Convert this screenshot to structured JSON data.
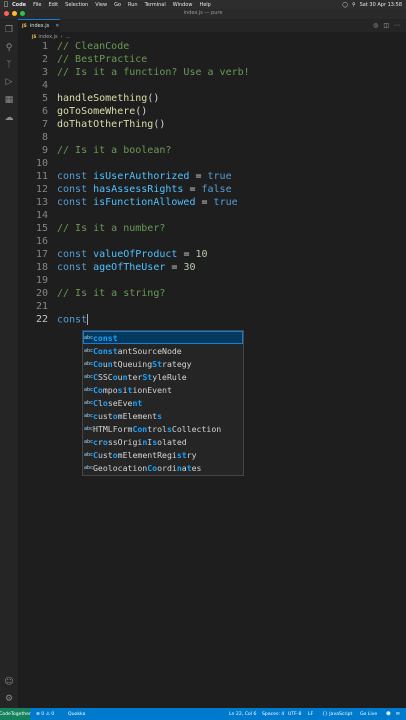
{
  "menubar": {
    "apple": "",
    "app": "Code",
    "items": [
      "File",
      "Edit",
      "Selection",
      "View",
      "Go",
      "Run",
      "Terminal",
      "Window",
      "Help"
    ],
    "clock": "Sat 30 Apr 13:58"
  },
  "window": {
    "title": "index.js — pure"
  },
  "tab": {
    "icon": "JS",
    "label": "index.js"
  },
  "breadcrumb": {
    "file": "index.js",
    "rest": "..."
  },
  "editor": {
    "lines": [
      {
        "n": "1",
        "tokens": [
          {
            "t": "// CleanCode",
            "c": "comment"
          }
        ]
      },
      {
        "n": "2",
        "tokens": [
          {
            "t": "// BestPractice",
            "c": "comment"
          }
        ]
      },
      {
        "n": "3",
        "tokens": [
          {
            "t": "// Is it a function? Use a verb!",
            "c": "comment"
          }
        ]
      },
      {
        "n": "4",
        "tokens": []
      },
      {
        "n": "5",
        "tokens": [
          {
            "t": "handleSomething",
            "c": "fn"
          },
          {
            "t": "()",
            "c": "plain"
          }
        ]
      },
      {
        "n": "6",
        "tokens": [
          {
            "t": "goToSomeWhere",
            "c": "fn"
          },
          {
            "t": "()",
            "c": "plain"
          }
        ]
      },
      {
        "n": "7",
        "tokens": [
          {
            "t": "doThatOtherThing",
            "c": "fn"
          },
          {
            "t": "()",
            "c": "plain"
          }
        ]
      },
      {
        "n": "8",
        "tokens": []
      },
      {
        "n": "9",
        "tokens": [
          {
            "t": "// Is it a boolean?",
            "c": "comment"
          }
        ]
      },
      {
        "n": "10",
        "tokens": []
      },
      {
        "n": "11",
        "tokens": [
          {
            "t": "const ",
            "c": "kw"
          },
          {
            "t": "isUserAuthorized",
            "c": "var"
          },
          {
            "t": " = ",
            "c": "plain"
          },
          {
            "t": "true",
            "c": "kw"
          }
        ]
      },
      {
        "n": "12",
        "tokens": [
          {
            "t": "const ",
            "c": "kw"
          },
          {
            "t": "hasAssessRights",
            "c": "var"
          },
          {
            "t": " = ",
            "c": "plain"
          },
          {
            "t": "false",
            "c": "kw"
          }
        ]
      },
      {
        "n": "13",
        "tokens": [
          {
            "t": "const ",
            "c": "kw"
          },
          {
            "t": "isFunctionAllowed",
            "c": "var"
          },
          {
            "t": " = ",
            "c": "plain"
          },
          {
            "t": "true",
            "c": "kw"
          }
        ]
      },
      {
        "n": "14",
        "tokens": []
      },
      {
        "n": "15",
        "tokens": [
          {
            "t": "// Is it a number?",
            "c": "comment"
          }
        ]
      },
      {
        "n": "16",
        "tokens": []
      },
      {
        "n": "17",
        "tokens": [
          {
            "t": "const ",
            "c": "kw"
          },
          {
            "t": "valueOfProduct",
            "c": "var"
          },
          {
            "t": " = ",
            "c": "plain"
          },
          {
            "t": "10",
            "c": "num"
          }
        ]
      },
      {
        "n": "18",
        "tokens": [
          {
            "t": "const ",
            "c": "kw"
          },
          {
            "t": "ageOfTheUser",
            "c": "var"
          },
          {
            "t": " = ",
            "c": "plain"
          },
          {
            "t": "30",
            "c": "num"
          }
        ]
      },
      {
        "n": "19",
        "tokens": []
      },
      {
        "n": "20",
        "tokens": [
          {
            "t": "// Is it a string?",
            "c": "comment"
          }
        ]
      },
      {
        "n": "21",
        "tokens": []
      },
      {
        "n": "22",
        "active": true,
        "tokens": [
          {
            "t": "const",
            "c": "kw"
          }
        ],
        "cursor": true
      }
    ]
  },
  "suggestions": [
    {
      "kind": "abc",
      "parts": [
        {
          "t": "const",
          "h": true
        }
      ],
      "selected": true
    },
    {
      "kind": "abc",
      "parts": [
        {
          "t": "Const",
          "h": true
        },
        {
          "t": "antSourceNode",
          "h": false
        }
      ]
    },
    {
      "kind": "abc",
      "parts": [
        {
          "t": "Co",
          "h": true
        },
        {
          "t": "u",
          "h": false
        },
        {
          "t": "n",
          "h": true
        },
        {
          "t": "tQueuing",
          "h": false
        },
        {
          "t": "St",
          "h": true
        },
        {
          "t": "rategy",
          "h": false
        }
      ]
    },
    {
      "kind": "abc",
      "parts": [
        {
          "t": "C",
          "h": true
        },
        {
          "t": "SSC",
          "h": false
        },
        {
          "t": "o",
          "h": true
        },
        {
          "t": "u",
          "h": false
        },
        {
          "t": "n",
          "h": true
        },
        {
          "t": "ter",
          "h": false
        },
        {
          "t": "St",
          "h": true
        },
        {
          "t": "yleRule",
          "h": false
        }
      ]
    },
    {
      "kind": "abc",
      "parts": [
        {
          "t": "Co",
          "h": true
        },
        {
          "t": "mpo",
          "h": false
        },
        {
          "t": "s",
          "h": true
        },
        {
          "t": "i",
          "h": false
        },
        {
          "t": "t",
          "h": true
        },
        {
          "t": "ionEve",
          "h": false
        },
        {
          "t": "nt",
          "h": false
        }
      ]
    },
    {
      "kind": "abc",
      "parts": [
        {
          "t": "C",
          "h": true
        },
        {
          "t": "l",
          "h": false
        },
        {
          "t": "o",
          "h": true
        },
        {
          "t": "seEve",
          "h": false
        },
        {
          "t": "nt",
          "h": true
        }
      ]
    },
    {
      "kind": "abc",
      "parts": [
        {
          "t": "c",
          "h": true
        },
        {
          "t": "ust",
          "h": false
        },
        {
          "t": "o",
          "h": true
        },
        {
          "t": "mElement",
          "h": false
        },
        {
          "t": "s",
          "h": true
        }
      ]
    },
    {
      "kind": "abc",
      "parts": [
        {
          "t": "HTMLForm",
          "h": false
        },
        {
          "t": "Con",
          "h": true
        },
        {
          "t": "trol",
          "h": false
        },
        {
          "t": "s",
          "h": true
        },
        {
          "t": "Collection",
          "h": false
        }
      ]
    },
    {
      "kind": "abc",
      "parts": [
        {
          "t": "c",
          "h": true
        },
        {
          "t": "r",
          "h": false
        },
        {
          "t": "o",
          "h": true
        },
        {
          "t": "ssOrigi",
          "h": false
        },
        {
          "t": "n",
          "h": true
        },
        {
          "t": "I",
          "h": false
        },
        {
          "t": "s",
          "h": true
        },
        {
          "t": "olated",
          "h": false
        }
      ]
    },
    {
      "kind": "abc",
      "parts": [
        {
          "t": "C",
          "h": true
        },
        {
          "t": "ust",
          "h": false
        },
        {
          "t": "o",
          "h": true
        },
        {
          "t": "mElementRegi",
          "h": false
        },
        {
          "t": "st",
          "h": true
        },
        {
          "t": "ry",
          "h": false
        }
      ]
    },
    {
      "kind": "abc",
      "parts": [
        {
          "t": "Geolocation",
          "h": false
        },
        {
          "t": "Co",
          "h": true
        },
        {
          "t": "ordi",
          "h": false
        },
        {
          "t": "n",
          "h": true
        },
        {
          "t": "a",
          "h": false
        },
        {
          "t": "t",
          "h": true
        },
        {
          "t": "es",
          "h": false
        }
      ]
    }
  ],
  "statusbar": {
    "remote": "CodeTogether",
    "problems": "⊗ 0  ⚠ 0",
    "quokka": "Quokka",
    "position": "Ln 22, Col 6",
    "spaces": "Spaces: 4",
    "encoding": "UTF-8",
    "eol": "LF",
    "language": "{} JavaScript",
    "golive": "Go Live"
  },
  "colors": {
    "accent": "#007acc",
    "remote": "#16825d"
  }
}
